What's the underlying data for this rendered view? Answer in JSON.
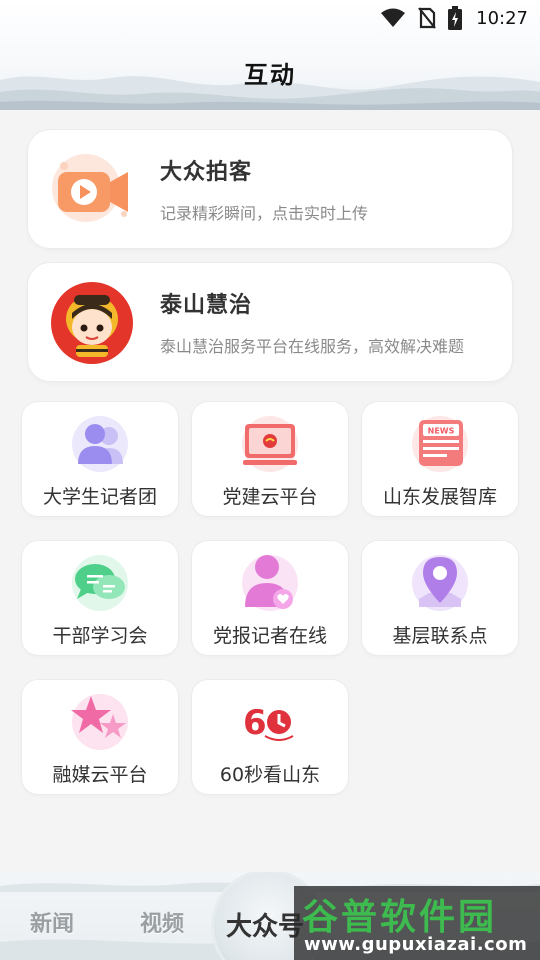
{
  "status_bar": {
    "time": "10:27",
    "icons": [
      "wifi-icon",
      "no-sim-icon",
      "battery-charging-icon"
    ]
  },
  "header": {
    "title": "互动"
  },
  "cards": [
    {
      "title": "大众拍客",
      "description": "记录精彩瞬间，点击实时上传",
      "icon": "video-camera-icon"
    },
    {
      "title": "泰山慧治",
      "description": "泰山慧治服务平台在线服务，高效解决难题",
      "icon": "mascot-avatar-icon"
    }
  ],
  "grid": [
    {
      "label": "大学生记者团",
      "icon": "users-icon"
    },
    {
      "label": "党建云平台",
      "icon": "monitor-icon"
    },
    {
      "label": "山东发展智库",
      "icon": "news-icon"
    },
    {
      "label": "干部学习会",
      "icon": "chat-bubbles-icon"
    },
    {
      "label": "党报记者在线",
      "icon": "user-heart-icon"
    },
    {
      "label": "基层联系点",
      "icon": "map-pin-icon"
    },
    {
      "label": "融媒云平台",
      "icon": "stars-icon"
    },
    {
      "label": "60秒看山东",
      "icon": "sixty-seconds-logo-icon"
    }
  ],
  "bottom_nav": {
    "items": [
      "新闻",
      "视频"
    ],
    "center_label": "大众号"
  },
  "watermark": {
    "title": "谷普软件园",
    "url": "www.gupuxiazai.com"
  },
  "colors": {
    "accent_orange": "#f7925f",
    "accent_purple": "#9b8cf0",
    "accent_red": "#f25b63",
    "accent_green": "#4fd08a",
    "accent_pink": "#f06bd6",
    "watermark_green": "#3dbb4f"
  }
}
